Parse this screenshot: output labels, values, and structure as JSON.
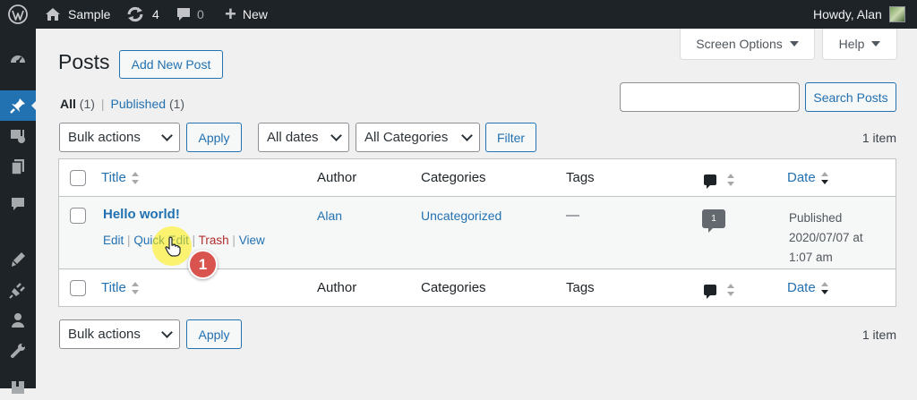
{
  "adminbar": {
    "site_name": "Sample",
    "updates_count": "4",
    "comments_count": "0",
    "new_label": "New",
    "greeting": "Howdy, Alan"
  },
  "screen_options": {
    "label": "Screen Options",
    "help_label": "Help"
  },
  "page": {
    "title": "Posts",
    "add_new_label": "Add New Post"
  },
  "views": {
    "all_label": "All",
    "all_count": "(1)",
    "separator": "|",
    "published_label": "Published",
    "published_count": "(1)"
  },
  "search": {
    "value": "",
    "button_label": "Search Posts"
  },
  "tablenav_top": {
    "bulk_actions": "Bulk actions",
    "apply_label": "Apply",
    "dates_filter": "All dates",
    "categories_filter": "All Categories",
    "filter_label": "Filter",
    "item_count": "1 item"
  },
  "table": {
    "columns": {
      "title": "Title",
      "author": "Author",
      "categories": "Categories",
      "tags": "Tags",
      "date": "Date"
    },
    "rows": [
      {
        "title": "Hello world!",
        "author": "Alan",
        "category": "Uncategorized",
        "tags": "—",
        "comments": "1",
        "date_status": "Published",
        "date_value": "2020/07/07 at",
        "date_time": "1:07 am",
        "actions": {
          "edit": "Edit",
          "quick_edit": "Quick Edit",
          "trash": "Trash",
          "view": "View",
          "separator": "|"
        }
      }
    ]
  },
  "tablenav_bottom": {
    "bulk_actions": "Bulk actions",
    "apply_label": "Apply",
    "item_count": "1 item"
  },
  "annotation": {
    "step_number": "1"
  },
  "colors": {
    "admin_dark": "#1d2327",
    "accent_blue": "#2271b1",
    "trash_red": "#b32d2e",
    "highlight_yellow": "#ffee00",
    "badge_red": "#d9534f"
  }
}
